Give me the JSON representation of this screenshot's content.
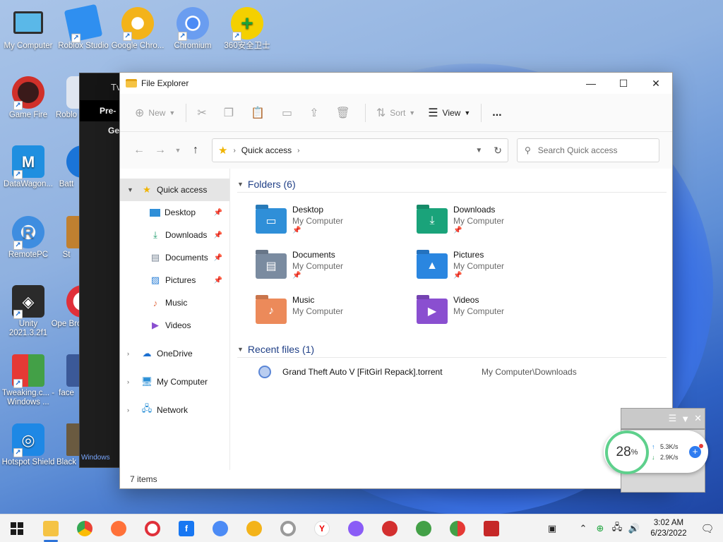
{
  "desktop": {
    "icons": [
      {
        "label": "My Computer"
      },
      {
        "label": "Roblox Studio"
      },
      {
        "label": "Google Chro..."
      },
      {
        "label": "Chromium"
      },
      {
        "label": "360安全卫士"
      },
      {
        "label": "Game Fire"
      },
      {
        "label": "Roblo"
      },
      {
        "label": "DataWagon..."
      },
      {
        "label": "Batt"
      },
      {
        "label": "RemotePC"
      },
      {
        "label": "St"
      },
      {
        "label": "Unity 2021.3.2f1"
      },
      {
        "label": "Ope Bro"
      },
      {
        "label": "Tweaking.c... - Windows ..."
      },
      {
        "label": "face"
      },
      {
        "label": "Hotspot Shield"
      },
      {
        "label": "Black"
      }
    ]
  },
  "background_window": {
    "title": "Tv",
    "subtitle": "Pre-",
    "tab": "Ge",
    "footer": "Windows"
  },
  "explorer": {
    "title": "File Explorer",
    "commands": {
      "new": "New",
      "sort": "Sort",
      "view": "View",
      "more": "..."
    },
    "address": {
      "crumb": "Quick access",
      "search_placeholder": "Search Quick access"
    },
    "nav": {
      "quick_access": "Quick access",
      "pinned": [
        "Desktop",
        "Downloads",
        "Documents",
        "Pictures"
      ],
      "unpinned": [
        "Music",
        "Videos"
      ],
      "onedrive": "OneDrive",
      "my_computer": "My Computer",
      "network": "Network"
    },
    "folders_header": "Folders (6)",
    "folders": [
      {
        "name": "Desktop",
        "location": "My Computer"
      },
      {
        "name": "Downloads",
        "location": "My Computer"
      },
      {
        "name": "Documents",
        "location": "My Computer"
      },
      {
        "name": "Pictures",
        "location": "My Computer"
      },
      {
        "name": "Music",
        "location": "My Computer"
      },
      {
        "name": "Videos",
        "location": "My Computer"
      }
    ],
    "recent_header": "Recent files (1)",
    "recent_files": [
      {
        "name": "Grand Theft Auto V [FitGirl Repack].torrent",
        "path": "My Computer\\Downloads"
      }
    ],
    "status": "7 items"
  },
  "widget": {
    "percent": "28",
    "percent_unit": "%",
    "upload": "5.3K/s",
    "download": "2.9K/s",
    "ok": "OK"
  },
  "taskbar": {
    "time": "3:02 AM",
    "date": "6/23/2022"
  },
  "colors": {
    "accent": "#2d73d8",
    "folder_header": "#1f3f86",
    "selection": "#e5e5e5"
  }
}
